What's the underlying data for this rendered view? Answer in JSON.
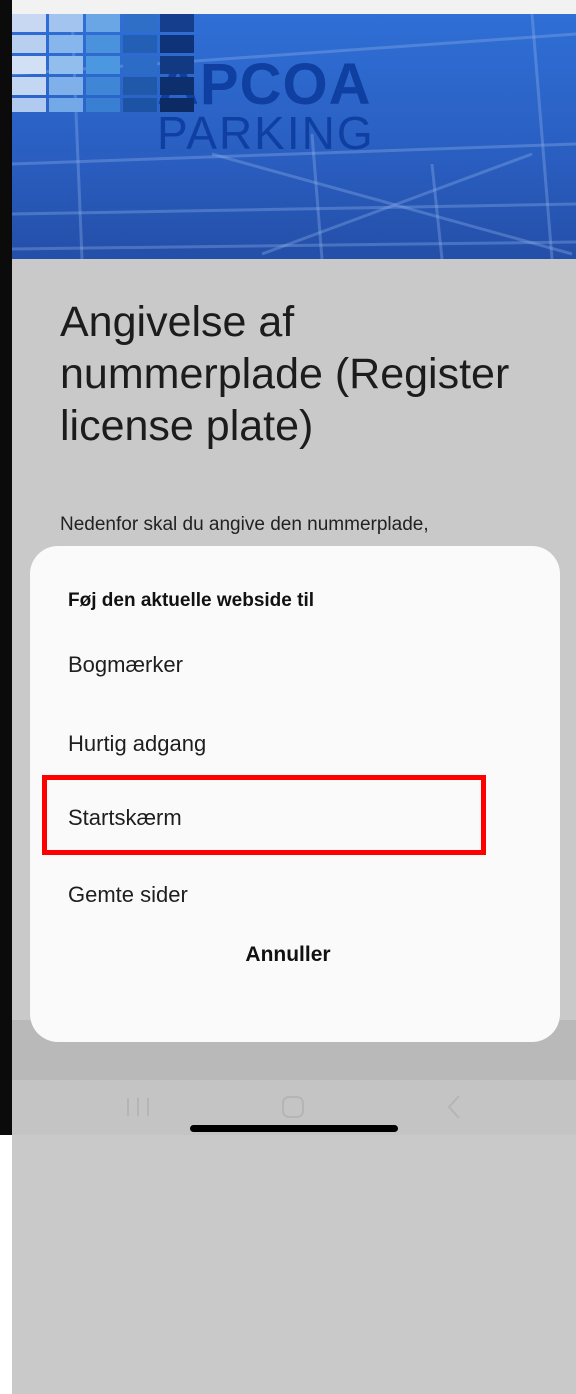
{
  "header": {
    "logo_line1": "APCOA",
    "logo_line2": "PARKING"
  },
  "page": {
    "title": "Angivelse af nummerplade (Register license plate)",
    "description": "Nedenfor skal du angive den nummerplade,"
  },
  "sheet": {
    "heading": "Føj den aktuelle webside til",
    "items": [
      {
        "label": "Bogmærker"
      },
      {
        "label": "Hurtig adgang"
      },
      {
        "label": "Startskærm",
        "highlighted": true
      },
      {
        "label": "Gemte sider"
      }
    ],
    "cancel_label": "Annuller"
  },
  "colors": {
    "brand_blue": "#0f3fa0",
    "highlight": "#ff0000"
  },
  "navbar": {
    "icons": [
      "recent-apps-icon",
      "home-icon",
      "back-icon"
    ]
  }
}
